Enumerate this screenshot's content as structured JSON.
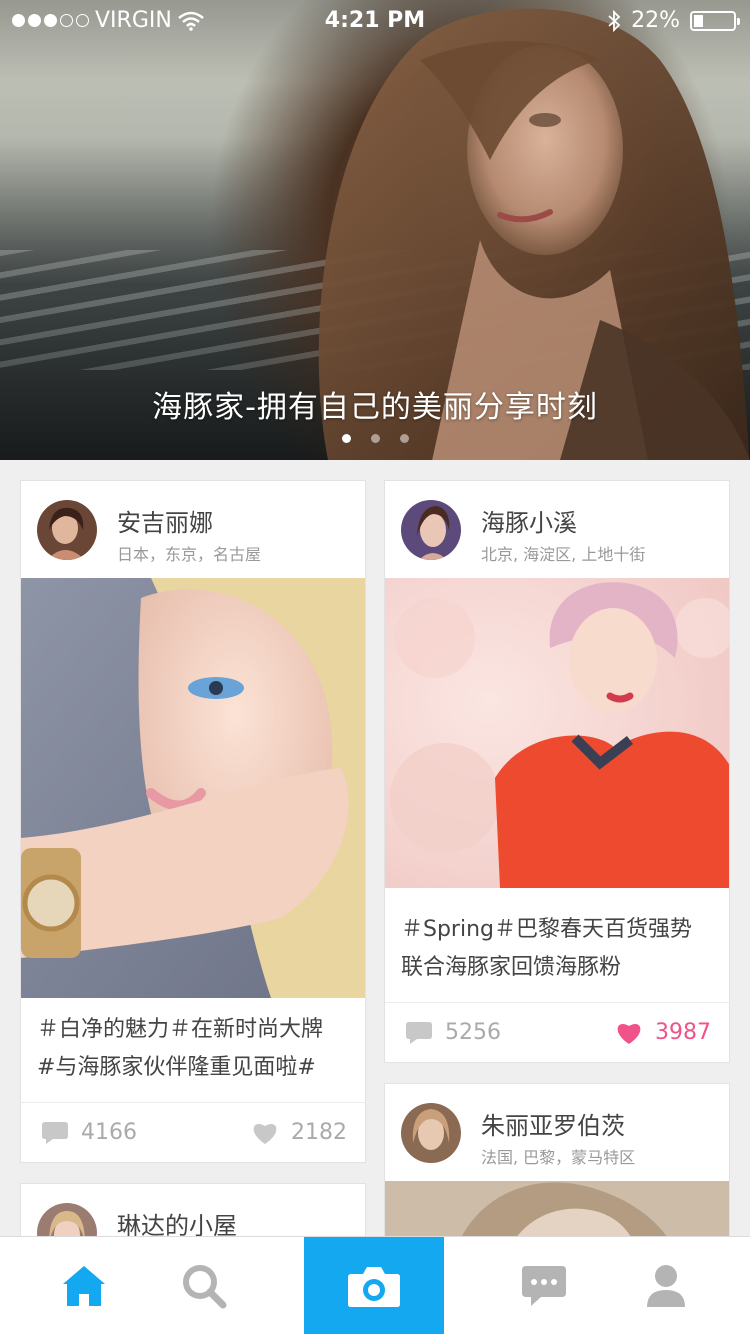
{
  "status_bar": {
    "carrier": "VIRGIN",
    "time": "4:21 PM",
    "battery": "22%",
    "signal_filled": 3,
    "signal_total": 5
  },
  "hero": {
    "caption": "海豚家-拥有自己的美丽分享时刻",
    "page_count": 3,
    "active_page": 1
  },
  "cards": [
    {
      "name": "安吉丽娜",
      "location": "日本，东京，名古屋",
      "text_line1": "＃白净的魅力＃在新时尚大牌",
      "text_line2": "#与海豚家伙伴隆重见面啦#",
      "comments": "4166",
      "likes": "2182",
      "liked": false
    },
    {
      "name": "海豚小溪",
      "location": "北京, 海淀区, 上地十街",
      "text_line1": "＃Spring＃巴黎春天百货强势",
      "text_line2": "联合海豚家回馈海豚粉",
      "comments": "5256",
      "likes": "3987",
      "liked": true
    },
    {
      "name": "朱丽亚罗伯茨",
      "location": "法国, 巴黎，蒙马特区"
    },
    {
      "name": "琳达的小屋"
    }
  ],
  "tabbar": {
    "items": [
      "home-icon",
      "search-icon",
      "camera-icon",
      "message-icon",
      "profile-icon"
    ],
    "active": "home-icon",
    "accent": "#14a8f0",
    "inactive": "#b4b4b4"
  }
}
